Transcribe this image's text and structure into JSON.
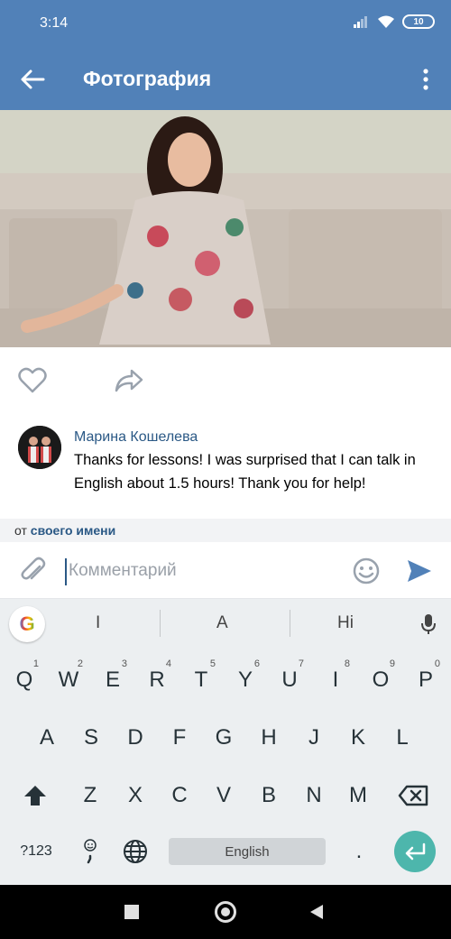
{
  "status_bar": {
    "time": "3:14",
    "battery": "10"
  },
  "header": {
    "title": "Фотография"
  },
  "comment": {
    "author": "Марина Кошелева",
    "text": "Thanks for lessons! I was surprised that I can talk in English about 1.5 hours! Thank you for help!"
  },
  "from_name": {
    "prefix": "от",
    "link": "своего имени"
  },
  "input": {
    "placeholder": "Комментарий"
  },
  "keyboard": {
    "suggestions": [
      "I",
      "A",
      "Hi"
    ],
    "row1": [
      {
        "key": "Q",
        "sup": "1"
      },
      {
        "key": "W",
        "sup": "2"
      },
      {
        "key": "E",
        "sup": "3"
      },
      {
        "key": "R",
        "sup": "4"
      },
      {
        "key": "T",
        "sup": "5"
      },
      {
        "key": "Y",
        "sup": "6"
      },
      {
        "key": "U",
        "sup": "7"
      },
      {
        "key": "I",
        "sup": "8"
      },
      {
        "key": "O",
        "sup": "9"
      },
      {
        "key": "P",
        "sup": "0"
      }
    ],
    "row2": [
      "A",
      "S",
      "D",
      "F",
      "G",
      "H",
      "J",
      "K",
      "L"
    ],
    "row3": [
      "Z",
      "X",
      "C",
      "V",
      "B",
      "N",
      "M"
    ],
    "symbols_label": "?123",
    "space_label": "English",
    "period_label": ".",
    "google_label": "G"
  },
  "colors": {
    "brand": "#5181b8",
    "link": "#2a5885",
    "accent": "#4db6ac"
  }
}
